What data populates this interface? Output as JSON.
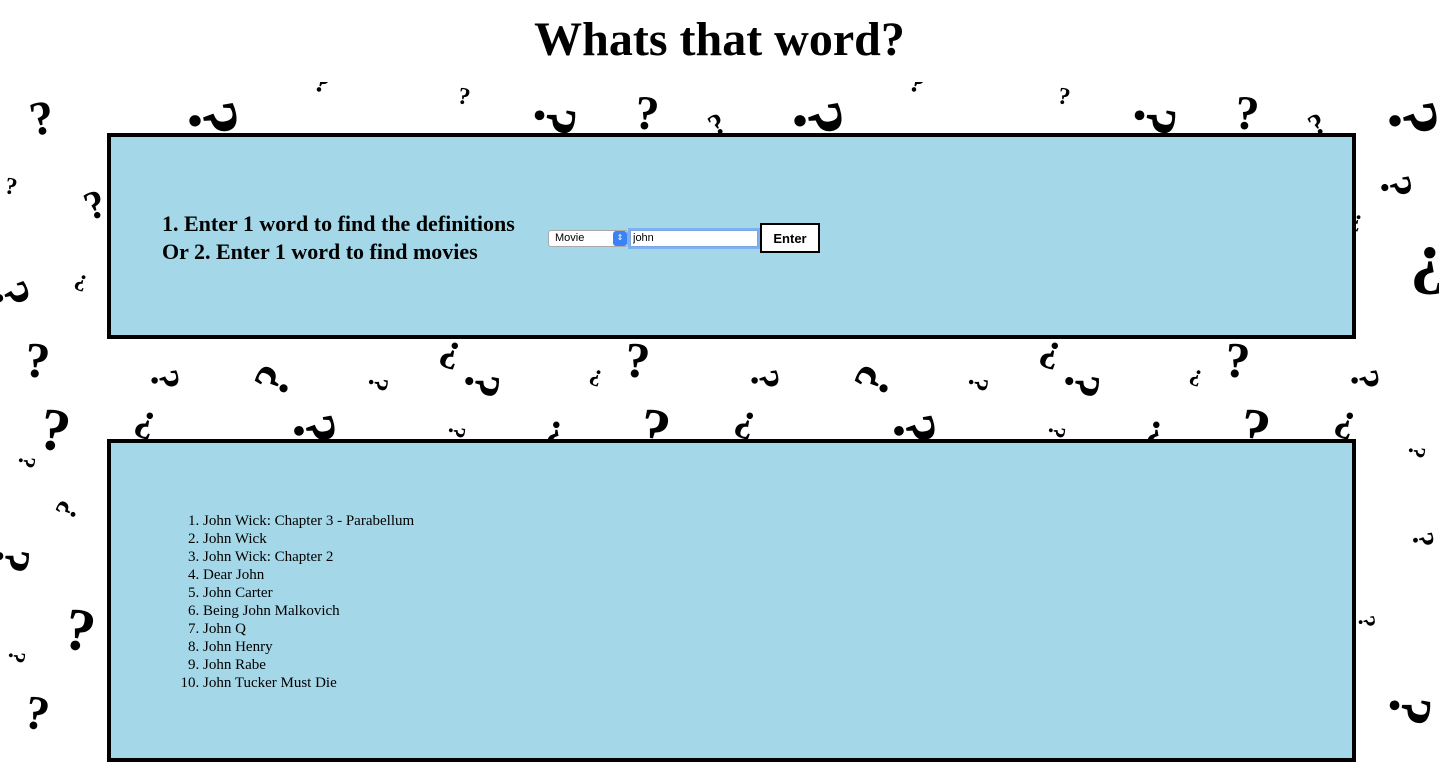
{
  "page": {
    "title": "Whats that word?"
  },
  "search": {
    "instruction_line1": "1. Enter 1 word to find the definitions",
    "instruction_line2": "Or 2. Enter 1 word to find movies",
    "mode_selected": "Movie",
    "query_value": "john",
    "enter_label": "Enter"
  },
  "results": {
    "items": [
      "John Wick: Chapter 3 - Parabellum",
      "John Wick",
      "John Wick: Chapter 2",
      "Dear John",
      "John Carter",
      "Being John Malkovich",
      "John Q",
      "John Henry",
      "John Rabe",
      "John Tucker Must Die"
    ]
  },
  "colors": {
    "panel_background": "#a4d7e8",
    "panel_border": "#000000",
    "page_background": "#ffffff",
    "select_arrow": "#3a82f7"
  }
}
